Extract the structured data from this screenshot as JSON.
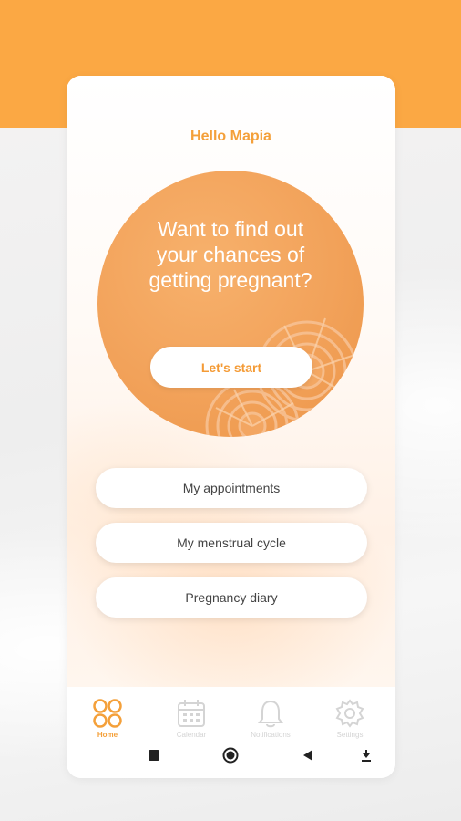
{
  "header": {
    "greeting": "Hello Mapia"
  },
  "hero": {
    "title": "Want to find out\nyour chances of\ngetting pregnant?",
    "cta_label": "Let's start"
  },
  "menu": [
    {
      "label": "My appointments"
    },
    {
      "label": "My menstrual cycle"
    },
    {
      "label": "Pregnancy diary"
    }
  ],
  "tabbar": {
    "active": "Home",
    "items": [
      {
        "label": "Home",
        "icon": "home-circles-icon"
      },
      {
        "label": "Calendar",
        "icon": "calendar-icon"
      },
      {
        "label": "Notifications",
        "icon": "bell-icon"
      },
      {
        "label": "Settings",
        "icon": "gear-icon"
      }
    ]
  },
  "system_nav": [
    "square-icon",
    "home-circle-icon",
    "back-triangle-icon",
    "down-arrow-icon"
  ],
  "colors": {
    "accent": "#f4a03a",
    "header_bg": "#fba844",
    "hero_circle": "#f2a25a",
    "button_text": "#444444",
    "inactive_tab": "#d4d4d4"
  }
}
